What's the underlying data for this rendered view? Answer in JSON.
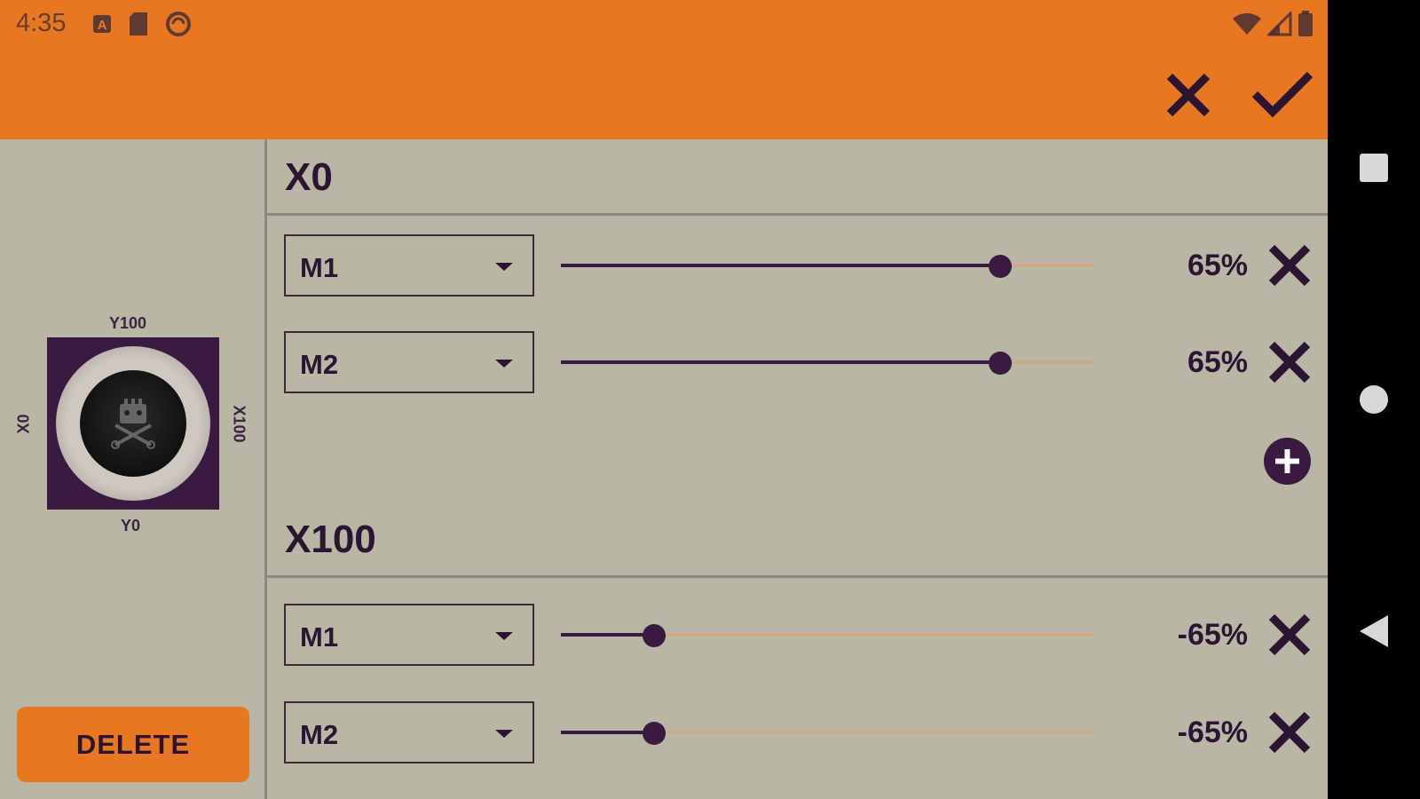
{
  "status_bar": {
    "time": "4:35",
    "left_icons": [
      "a-notification-icon",
      "sd-card-icon",
      "sync-icon"
    ],
    "right_icons": [
      "wifi-icon",
      "cell-signal-icon",
      "battery-icon"
    ]
  },
  "toolbar": {
    "cancel_icon": "close-icon",
    "confirm_icon": "checkmark-icon"
  },
  "joystick": {
    "label_top": "Y100",
    "label_bottom": "Y0",
    "label_left": "X0",
    "label_right": "X100",
    "knob_icon": "robot-skull-crossbones-icon"
  },
  "delete_label": "DELETE",
  "sections": [
    {
      "title": "X0",
      "rows": [
        {
          "motor": "M1",
          "value_label": "65%",
          "slider_fraction": 0.825
        },
        {
          "motor": "M2",
          "value_label": "65%",
          "slider_fraction": 0.825
        }
      ]
    },
    {
      "title": "X100",
      "rows": [
        {
          "motor": "M1",
          "value_label": "-65%",
          "slider_fraction": 0.175
        },
        {
          "motor": "M2",
          "value_label": "-65%",
          "slider_fraction": 0.175
        }
      ]
    }
  ],
  "add_icon": "plus-circle-icon",
  "nav_bar": {
    "recents_icon": "square-icon",
    "home_icon": "circle-icon",
    "back_icon": "back-triangle-icon"
  },
  "colors": {
    "accent": "#e87722",
    "background": "#b9b6a6",
    "dark": "#3a1a40"
  }
}
